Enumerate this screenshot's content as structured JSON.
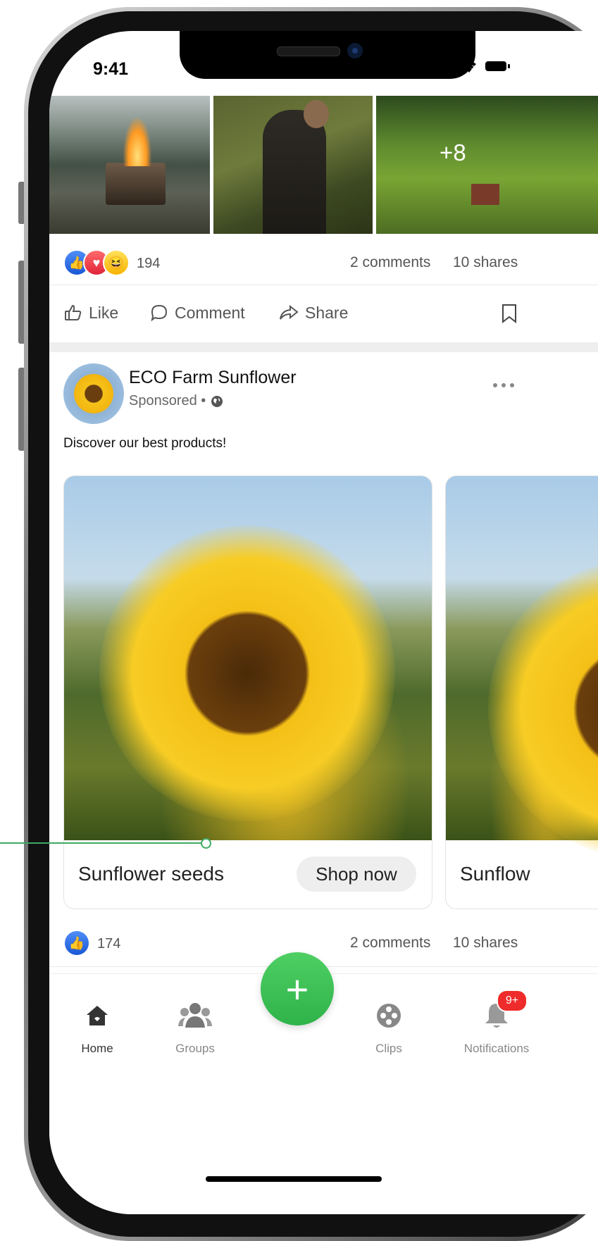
{
  "status_bar": {
    "time": "9:41"
  },
  "photo_grid": {
    "more_count": "+8"
  },
  "post1": {
    "reaction_count": "194",
    "comments": "2 comments",
    "shares": "10 shares",
    "actions": {
      "like": "Like",
      "comment": "Comment",
      "share": "Share"
    }
  },
  "post2": {
    "page_name": "ECO Farm Sunflower",
    "sponsored": "Sponsored •",
    "text": "Discover our best products!",
    "cards": [
      {
        "title": "Sunflower seeds",
        "cta": "Shop now"
      },
      {
        "title": "Sunflow"
      }
    ],
    "reaction_count": "174",
    "comments": "2 comments",
    "shares": "10 shares"
  },
  "nav": {
    "home": "Home",
    "groups": "Groups",
    "clips": "Clips",
    "notifications": "Notifications",
    "notifications_badge": "9+",
    "fab": "+"
  },
  "colors": {
    "accent_green": "#2eb34a",
    "badge_red": "#ef2b2b",
    "like_blue": "#1a57d6"
  }
}
